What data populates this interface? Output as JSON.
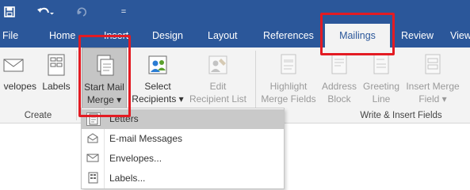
{
  "quick_access": {
    "save_icon": "save-icon",
    "undo_icon": "undo-icon",
    "undo_dropdown": "▾",
    "redo_icon": "redo-icon",
    "customize_glyph": "="
  },
  "tabs": [
    {
      "label": "File"
    },
    {
      "label": "Home"
    },
    {
      "label": "Insert"
    },
    {
      "label": "Design"
    },
    {
      "label": "Layout"
    },
    {
      "label": "References"
    },
    {
      "label": "Mailings",
      "active": true
    },
    {
      "label": "Review"
    },
    {
      "label": "View"
    }
  ],
  "ribbon": {
    "groups": {
      "create": "Create",
      "write_insert": "Write & Insert Fields"
    },
    "buttons": {
      "envelopes": "velopes",
      "labels": "Labels",
      "start_mail_merge_1": "Start Mail",
      "start_mail_merge_2": "Merge ▾",
      "select_recipients_1": "Select",
      "select_recipients_2": "Recipients ▾",
      "edit_recipient_1": "Edit",
      "edit_recipient_2": "Recipient List",
      "highlight_1": "Highlight",
      "highlight_2": "Merge Fields",
      "address_1": "Address",
      "address_2": "Block",
      "greeting_1": "Greeting",
      "greeting_2": "Line",
      "insert_merge_1": "Insert Merge",
      "insert_merge_2": "Field ▾"
    }
  },
  "dropdown": {
    "items": [
      {
        "label": "Letters",
        "icon": "letters-icon"
      },
      {
        "label": "E-mail Messages",
        "icon": "email-icon"
      },
      {
        "label": "Envelopes...",
        "icon": "envelope-icon"
      },
      {
        "label": "Labels...",
        "icon": "labels-icon"
      }
    ]
  },
  "colors": {
    "title_bar": "#2b579a",
    "ribbon": "#f3f3f3",
    "highlight_box": "#e31b23"
  }
}
